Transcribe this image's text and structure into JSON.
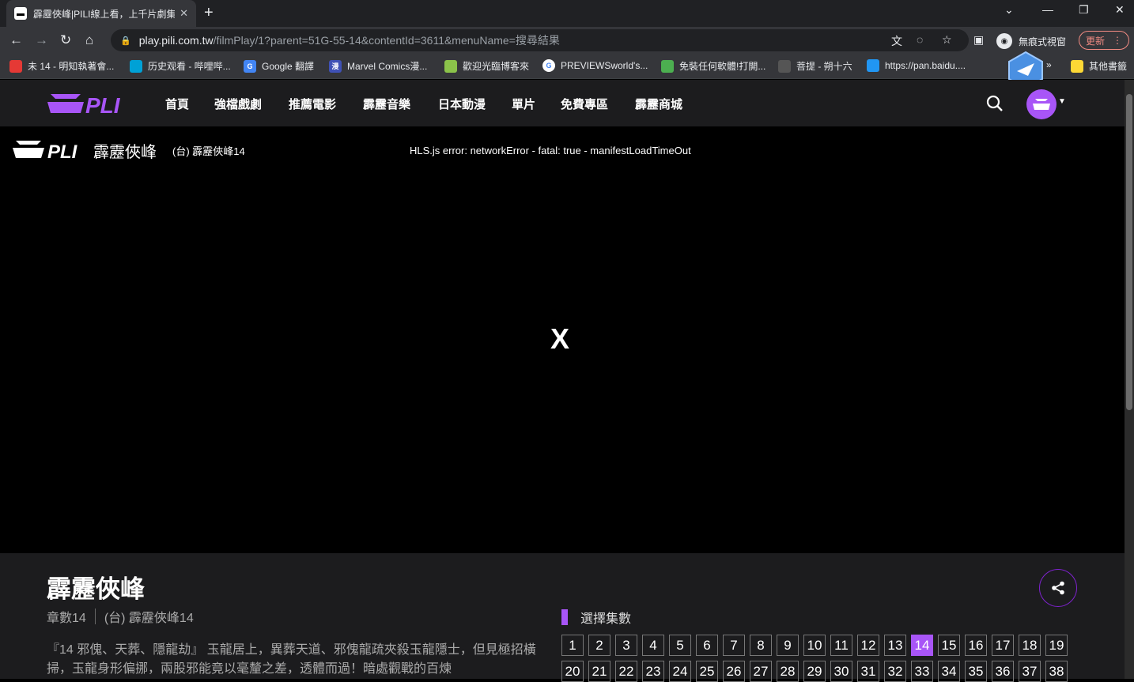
{
  "browser": {
    "tab_title": "霹靂俠峰|PILI線上看，上千片劇集",
    "url_host": "play.pili.com.tw",
    "url_path": "/filmPlay/1?parent=51G-55-14&contentId=3611&menuName=搜尋結果",
    "incognito_label": "無痕式視窗",
    "update_label": "更新",
    "bookmarks": [
      {
        "label": "未 14 - 明知執著會...",
        "color": "#e53935",
        "icon": "app-icon"
      },
      {
        "label": "历史观看 - 哔哩哔...",
        "color": "#00a1d6",
        "icon": "bilibili-icon"
      },
      {
        "label": "Google 翻譯",
        "color": "#4285f4",
        "icon": "translate-icon"
      },
      {
        "label": "Marvel Comics漫...",
        "color": "#3f51b5",
        "icon": "manga-icon"
      },
      {
        "label": "歡迎光臨博客來",
        "color": "#8bc34a",
        "icon": "books-icon"
      },
      {
        "label": "PREVIEWSworld's...",
        "color": "#ffffff",
        "icon": "google-icon"
      },
      {
        "label": "免裝任何軟體!打開...",
        "color": "#4caf50",
        "icon": "leaf-icon"
      },
      {
        "label": "菩提 - 朔十六",
        "color": "#555555",
        "icon": "page-icon"
      },
      {
        "label": "https://pan.baidu....",
        "color": "#2196f3",
        "icon": "baidu-icon"
      },
      {
        "label": "其他書籤",
        "color": "#fdd835",
        "icon": "folder-icon"
      }
    ]
  },
  "site": {
    "menu": [
      "首頁",
      "強檔戲劇",
      "推薦電影",
      "霹靂音樂",
      "日本動漫",
      "單片",
      "免費專區",
      "霹靂商城"
    ]
  },
  "player": {
    "title": "霹靂俠峰",
    "episode_label": "(台) 霹靂俠峰14",
    "error": "HLS.js error: networkError - fatal: true - manifestLoadTimeOut",
    "error_icon": "X"
  },
  "info": {
    "title": "霹靂俠峰",
    "chapter": "章數14",
    "episode_label": "(台) 霹靂俠峰14",
    "description": "『14 邪傀、天葬、隱龍劫』 玉龍居上，異葬天道、邪傀龍疏夾殺玉龍隱士，但見極招橫掃，玉龍身形偏挪，兩股邪能竟以毫釐之差，透體而過！暗處觀戰的百煉",
    "episodes_heading": "選擇集數",
    "episodes": [
      "1",
      "2",
      "3",
      "4",
      "5",
      "6",
      "7",
      "8",
      "9",
      "10",
      "11",
      "12",
      "13",
      "14",
      "15",
      "16",
      "17",
      "18",
      "19",
      "20",
      "21",
      "22",
      "23",
      "24",
      "25",
      "26",
      "27",
      "28",
      "29",
      "30",
      "31",
      "32",
      "33",
      "34",
      "35",
      "36",
      "37",
      "38"
    ],
    "active_episode": "14"
  }
}
